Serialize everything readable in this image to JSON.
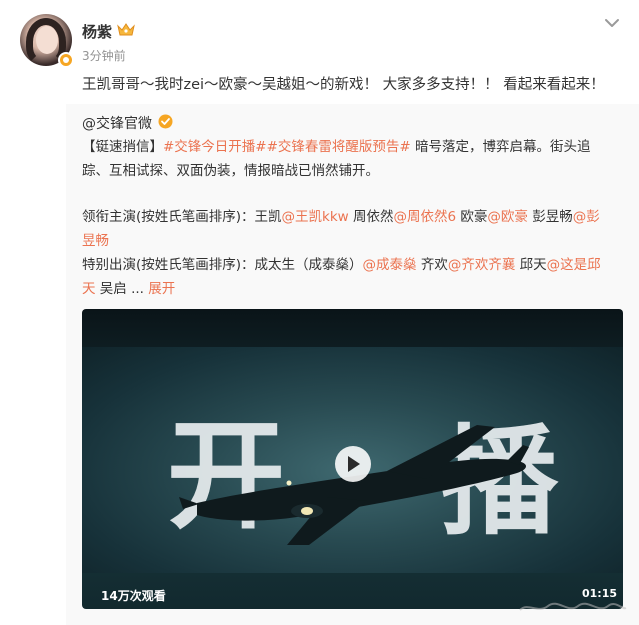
{
  "post": {
    "author": "杨紫",
    "timestamp": "3分钟前",
    "text": "王凯哥哥～我时zei～欧豪～吴越姐～的新戏！ 大家多多支持！！ 看起来看起来！"
  },
  "repost": {
    "author": "@交锋官微",
    "line1": {
      "prefix": "【铤速捎信】",
      "tag1": "#交锋今日开播#",
      "tag2": "#交锋春雷将醒版预告#",
      "suffix": " 暗号落定，博弈启幕。街头追"
    },
    "line2": "踪、互相试探、双面伪装，情报暗战已悄然铺开。",
    "cast1": {
      "label": "领衔主演(按姓氏笔画排序)：王凯",
      "m1": "@王凯kkw",
      "t1": " 周依然",
      "m2": "@周依然6",
      "t2": " 欧豪",
      "m3": "@欧豪",
      "t3": " 彭昱畅",
      "m4": "@彭",
      "m4b": "昱畅"
    },
    "cast2": {
      "label": "特别出演(按姓氏笔画排序)：成太生（成泰燊）",
      "m1": "@成泰燊",
      "t1": " 齐欢",
      "m2": "@齐欢齐襄",
      "t2": " 邱天",
      "m3": "@这是邱",
      "m3b": "天",
      "t3": " 吴启 ...",
      "expand": "展开"
    }
  },
  "video": {
    "char_left": "开",
    "char_right": "播",
    "views": "14万次观看",
    "duration": "01:15"
  },
  "colors": {
    "link": "#eb7350",
    "badge": "#f6a623",
    "verified": "#f6a623"
  },
  "icons": [
    "crown-icon",
    "chevron-down-icon",
    "verified-icon",
    "play-icon",
    "avatar-badge-icon"
  ]
}
